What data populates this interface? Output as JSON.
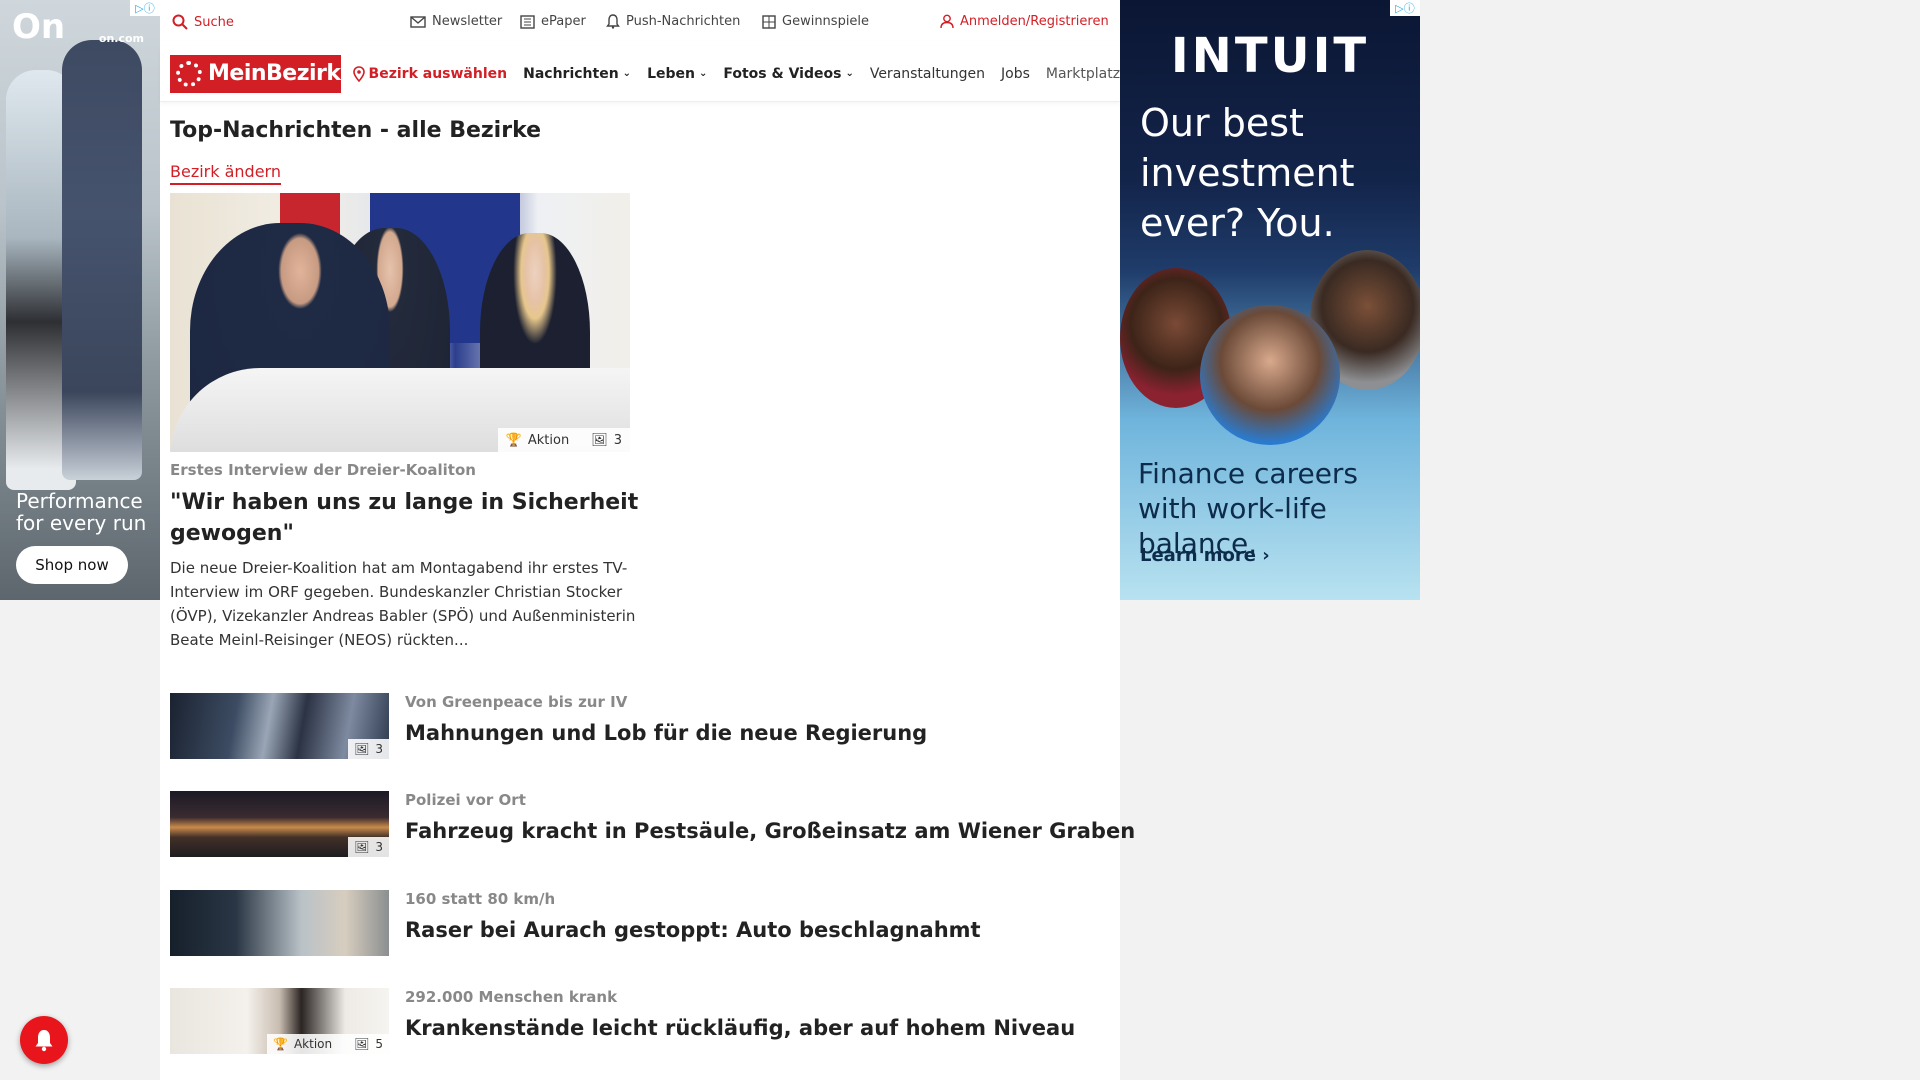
{
  "ads": {
    "left": {
      "brand": "On",
      "url": "on.com",
      "tagline": "Performance for every run",
      "cta": "Shop now"
    },
    "right": {
      "brand": "INTUIT",
      "headline": "Our best investment ever? You.",
      "subline": "Finance careers with work-life balance.",
      "cta": "Learn more ›"
    }
  },
  "topbar": {
    "search": "Suche",
    "newsletter": "Newsletter",
    "epaper": "ePaper",
    "push": "Push-Nachrichten",
    "contests": "Gewinnspiele",
    "login": "Anmelden/Registrieren"
  },
  "nav": {
    "logo": "MeinBezirk",
    "region": "Bezirk auswählen",
    "items": [
      "Nachrichten",
      "Leben",
      "Fotos & Videos",
      "Veranstaltungen",
      "Jobs",
      "Marktplatz"
    ]
  },
  "section": {
    "title": "Top-Nachrichten - alle Bezirke",
    "change_link": "Bezirk ändern"
  },
  "lead": {
    "badge_label": "Aktion",
    "badge_count": "3",
    "kicker": "Erstes Interview der Dreier-Koaliton",
    "title": "\"Wir haben uns zu lange in Sicherheit gewogen\"",
    "teaser": "Die neue Dreier-Koalition hat am Montagabend ihr erstes TV-Interview im ORF gegeben. Bundeskanzler Christian Stocker (ÖVP), Vizekanzler Andreas Babler (SPÖ) und Außenministerin Beate Meinl-Reisinger (NEOS) rückten..."
  },
  "articles": [
    {
      "kicker": "Von Greenpeace bis zur IV",
      "title": "Mahnungen und Lob für die neue Regierung",
      "badge_label": "",
      "badge_count": "3"
    },
    {
      "kicker": "Polizei vor Ort",
      "title": "Fahrzeug kracht in Pestsäule, Großeinsatz am Wiener Graben",
      "badge_label": "",
      "badge_count": "3"
    },
    {
      "kicker": "160 statt 80 km/h",
      "title": "Raser bei Aurach gestoppt: Auto beschlagnahmt",
      "badge_label": "",
      "badge_count": ""
    },
    {
      "kicker": "292.000 Menschen krank",
      "title": "Krankenstände leicht rückläufig, aber auf hohem Niveau",
      "badge_label": "Aktion",
      "badge_count": "5"
    }
  ],
  "colors": {
    "accent": "#d21f26",
    "notify_button": "#e8151c"
  },
  "icons": [
    "search-icon",
    "envelope-icon",
    "newspaper-icon",
    "bell-icon",
    "gift-icon",
    "user-icon",
    "map-pin-icon",
    "chevron-down-icon",
    "trophy-icon",
    "gallery-icon"
  ]
}
